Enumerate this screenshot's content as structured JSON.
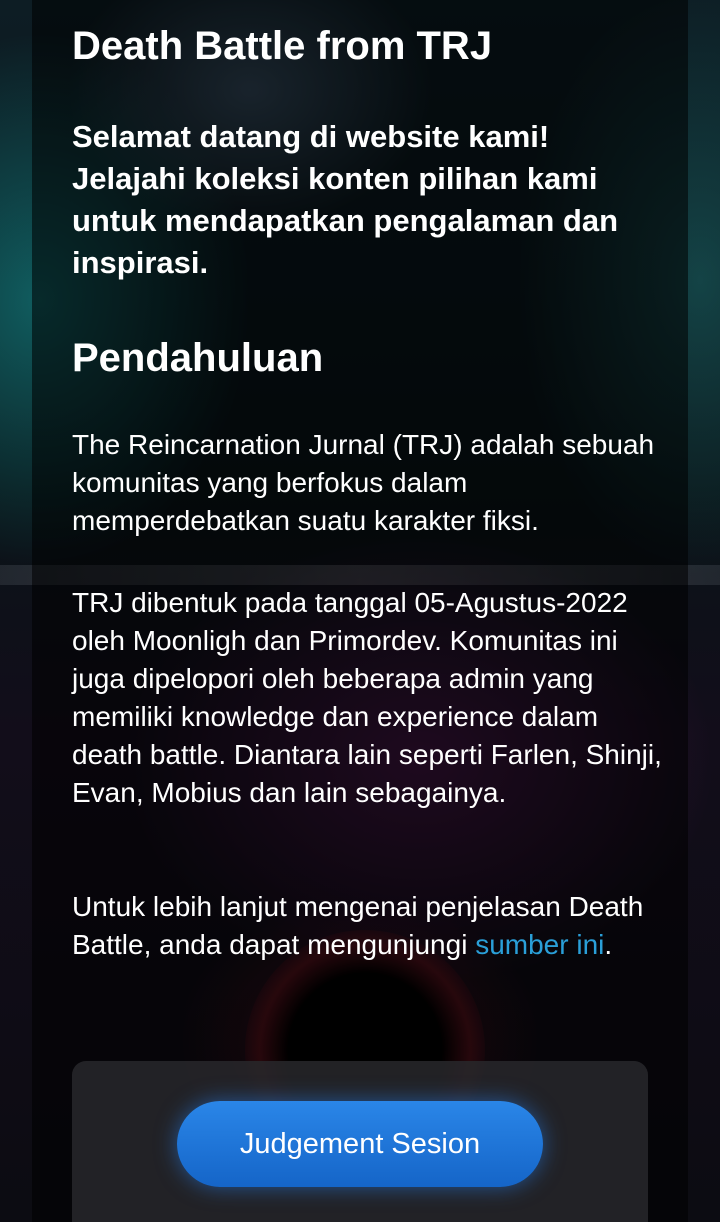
{
  "header": {
    "site_title": "Death Battle from TRJ",
    "welcome_text": "Selamat datang di website kami! Jelajahi koleksi konten pilihan kami untuk mendapatkan pengalaman dan inspirasi."
  },
  "intro": {
    "heading": "Pendahuluan",
    "paragraph1": "The Reincarnation Jurnal (TRJ) adalah sebuah komunitas yang berfokus dalam memperdebatkan suatu karakter fiksi.",
    "paragraph2": "TRJ dibentuk pada tanggal 05-Agustus-2022 oleh Moonligh dan Primordev. Komunitas ini juga dipelopori oleh beberapa admin yang memiliki knowledge dan experience dalam death battle. Diantara lain seperti Farlen, Shinji, Evan, Mobius dan lain sebagainya.",
    "paragraph3_prefix": "Untuk lebih lanjut mengenai penjelasan Death Battle, anda dapat mengunjungi ",
    "source_link": "sumber ini",
    "paragraph3_suffix": "."
  },
  "actions": {
    "judgement_button": "Judgement Sesion"
  },
  "colors": {
    "link": "#2a9fd8",
    "button": "#1f78dc",
    "text": "#ffffff"
  }
}
